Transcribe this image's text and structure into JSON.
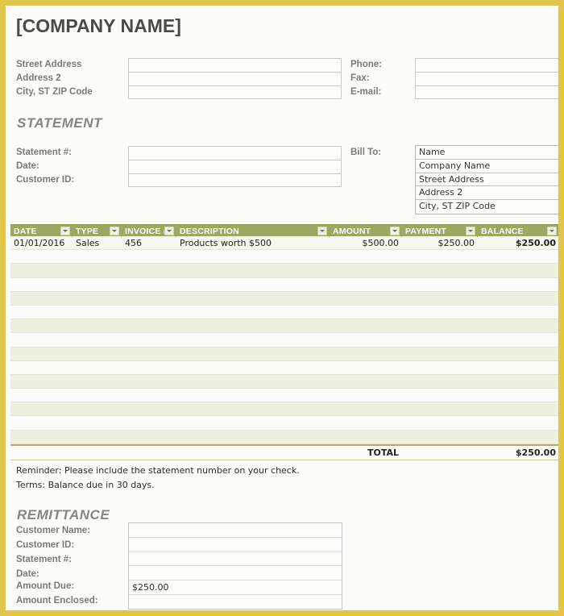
{
  "document": {
    "company_name": "[COMPANY NAME]",
    "accent_border_color": "#e3c54a",
    "table_header_color": "#9aa862",
    "stripe_color": "#edf0df"
  },
  "company_address": {
    "lines": [
      "Street Address",
      "Address 2",
      "City, ST  ZIP Code"
    ],
    "values": [
      "",
      "",
      ""
    ]
  },
  "contact": {
    "labels": [
      "Phone:",
      "Fax:",
      "E-mail:"
    ],
    "values": [
      "",
      "",
      ""
    ]
  },
  "statement": {
    "heading": "STATEMENT",
    "labels": [
      "Statement #:",
      "Date:",
      "Customer ID:"
    ],
    "values": [
      "",
      "",
      ""
    ]
  },
  "bill_to": {
    "label": "Bill To:",
    "lines": [
      "Name",
      "Company Name",
      "Street Address",
      "Address 2",
      "City, ST  ZIP Code"
    ]
  },
  "table": {
    "columns": [
      {
        "label": "DATE",
        "filter": "filter-dropdown-icon"
      },
      {
        "label": "TYPE",
        "filter": "filter-dropdown-icon"
      },
      {
        "label": "INVOICE #",
        "filter": "filter-dropdown-icon"
      },
      {
        "label": "DESCRIPTION",
        "filter": "filter-dropdown-icon"
      },
      {
        "label": "AMOUNT",
        "filter": "filter-dropdown-icon"
      },
      {
        "label": "PAYMENT",
        "filter": "filter-dropdown-icon"
      },
      {
        "label": "BALANCE",
        "filter": "filter-dropdown-icon"
      }
    ],
    "rows": [
      {
        "date": "01/01/2016",
        "type": "Sales",
        "invoice": "456",
        "description": "Products worth $500",
        "amount": "$500.00",
        "payment": "$250.00",
        "balance": "$250.00"
      },
      {
        "date": "",
        "type": "",
        "invoice": "",
        "description": "",
        "amount": "",
        "payment": "",
        "balance": ""
      },
      {
        "date": "",
        "type": "",
        "invoice": "",
        "description": "",
        "amount": "",
        "payment": "",
        "balance": ""
      },
      {
        "date": "",
        "type": "",
        "invoice": "",
        "description": "",
        "amount": "",
        "payment": "",
        "balance": ""
      },
      {
        "date": "",
        "type": "",
        "invoice": "",
        "description": "",
        "amount": "",
        "payment": "",
        "balance": ""
      },
      {
        "date": "",
        "type": "",
        "invoice": "",
        "description": "",
        "amount": "",
        "payment": "",
        "balance": ""
      },
      {
        "date": "",
        "type": "",
        "invoice": "",
        "description": "",
        "amount": "",
        "payment": "",
        "balance": ""
      },
      {
        "date": "",
        "type": "",
        "invoice": "",
        "description": "",
        "amount": "",
        "payment": "",
        "balance": ""
      },
      {
        "date": "",
        "type": "",
        "invoice": "",
        "description": "",
        "amount": "",
        "payment": "",
        "balance": ""
      },
      {
        "date": "",
        "type": "",
        "invoice": "",
        "description": "",
        "amount": "",
        "payment": "",
        "balance": ""
      },
      {
        "date": "",
        "type": "",
        "invoice": "",
        "description": "",
        "amount": "",
        "payment": "",
        "balance": ""
      },
      {
        "date": "",
        "type": "",
        "invoice": "",
        "description": "",
        "amount": "",
        "payment": "",
        "balance": ""
      },
      {
        "date": "",
        "type": "",
        "invoice": "",
        "description": "",
        "amount": "",
        "payment": "",
        "balance": ""
      },
      {
        "date": "",
        "type": "",
        "invoice": "",
        "description": "",
        "amount": "",
        "payment": "",
        "balance": ""
      },
      {
        "date": "",
        "type": "",
        "invoice": "",
        "description": "",
        "amount": "",
        "payment": "",
        "balance": ""
      }
    ],
    "total": {
      "label": "TOTAL",
      "value": "$250.00"
    }
  },
  "notes": {
    "reminder": "Reminder: Please include the statement number on your check.",
    "terms": "Terms: Balance due in 30 days."
  },
  "remittance": {
    "heading": "REMITTANCE",
    "labels": [
      "Customer Name:",
      "Customer ID:",
      "Statement #:",
      "Date:",
      "Amount Due:",
      "Amount Enclosed:"
    ],
    "values": [
      "",
      "",
      "",
      "",
      "$250.00",
      ""
    ]
  }
}
